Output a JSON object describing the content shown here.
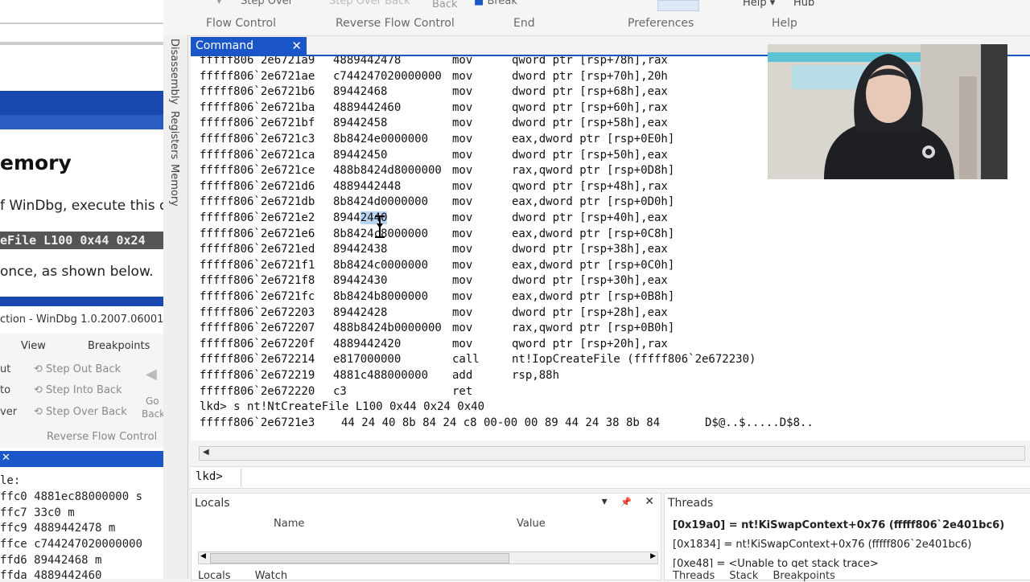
{
  "background_window": {
    "heading": "emory",
    "line1": "f WinDbg, execute this c",
    "code": "eFile L100 0x44 0x24",
    "line2": "once, as shown below.",
    "window_title": "ction  - WinDbg 1.0.2007.06001",
    "ribbon_tabs": [
      "View",
      "Breakpoints"
    ],
    "ribbon_left": [
      "ut",
      "to",
      "ver"
    ],
    "ribbon_items": [
      "Step Out Back",
      "Step Into Back",
      "Step Over Back"
    ],
    "ribbon_side": [
      "Go",
      "Back"
    ],
    "ribbon_group": "Reverse Flow Control",
    "close_glyph": "✕",
    "file_label": "le:",
    "asm_rows": [
      "ffc0 4881ec88000000  s",
      "ffc7 33c0              m",
      "ffc9 4889442478        m",
      "ffce c744247020000000",
      "ffd6 89442468          m",
      "ffda 4889442460"
    ]
  },
  "ribbon": {
    "top_items": [
      "Step Over",
      "Step Over Back",
      "Back",
      "Break"
    ],
    "groups": [
      "Flow Control",
      "Reverse Flow Control",
      "End",
      "Preferences",
      "Help"
    ],
    "help_menu": "Help ▾",
    "hub": "Hub"
  },
  "vertical_tabs": [
    "Disassembly",
    "Registers",
    "Memory"
  ],
  "command_tab": {
    "label": "Command",
    "close": "✕"
  },
  "disasm": [
    {
      "addr": "fffff806`2e6721a9",
      "bytes": "4889442478",
      "op": "mov",
      "args": "qword ptr [rsp+78h],rax"
    },
    {
      "addr": "fffff806`2e6721ae",
      "bytes": "c744247020000000",
      "op": "mov",
      "args": "dword ptr [rsp+70h],20h"
    },
    {
      "addr": "fffff806`2e6721b6",
      "bytes": "89442468",
      "op": "mov",
      "args": "dword ptr [rsp+68h],eax"
    },
    {
      "addr": "fffff806`2e6721ba",
      "bytes": "4889442460",
      "op": "mov",
      "args": "qword ptr [rsp+60h],rax"
    },
    {
      "addr": "fffff806`2e6721bf",
      "bytes": "89442458",
      "op": "mov",
      "args": "dword ptr [rsp+58h],eax"
    },
    {
      "addr": "fffff806`2e6721c3",
      "bytes": "8b8424e0000000",
      "op": "mov",
      "args": "eax,dword ptr [rsp+0E0h]"
    },
    {
      "addr": "fffff806`2e6721ca",
      "bytes": "89442450",
      "op": "mov",
      "args": "dword ptr [rsp+50h],eax"
    },
    {
      "addr": "fffff806`2e6721ce",
      "bytes": "488b8424d8000000",
      "op": "mov",
      "args": "rax,qword ptr [rsp+0D8h]"
    },
    {
      "addr": "fffff806`2e6721d6",
      "bytes": "4889442448",
      "op": "mov",
      "args": "qword ptr [rsp+48h],rax"
    },
    {
      "addr": "fffff806`2e6721db",
      "bytes": "8b8424d0000000",
      "op": "mov",
      "args": "eax,dword ptr [rsp+0D0h]"
    },
    {
      "addr": "fffff806`2e6721e2",
      "bytes": "89442440",
      "op": "mov",
      "args": "dword ptr [rsp+40h],eax"
    },
    {
      "addr": "fffff806`2e6721e6",
      "bytes": "8b8424c8000000",
      "op": "mov",
      "args": "eax,dword ptr [rsp+0C8h]"
    },
    {
      "addr": "fffff806`2e6721ed",
      "bytes": "89442438",
      "op": "mov",
      "args": "dword ptr [rsp+38h],eax"
    },
    {
      "addr": "fffff806`2e6721f1",
      "bytes": "8b8424c0000000",
      "op": "mov",
      "args": "eax,dword ptr [rsp+0C0h]"
    },
    {
      "addr": "fffff806`2e6721f8",
      "bytes": "89442430",
      "op": "mov",
      "args": "dword ptr [rsp+30h],eax"
    },
    {
      "addr": "fffff806`2e6721fc",
      "bytes": "8b8424b8000000",
      "op": "mov",
      "args": "eax,dword ptr [rsp+0B8h]"
    },
    {
      "addr": "fffff806`2e672203",
      "bytes": "89442428",
      "op": "mov",
      "args": "dword ptr [rsp+28h],eax"
    },
    {
      "addr": "fffff806`2e672207",
      "bytes": "488b8424b0000000",
      "op": "mov",
      "args": "rax,qword ptr [rsp+0B0h]"
    },
    {
      "addr": "fffff806`2e67220f",
      "bytes": "4889442420",
      "op": "mov",
      "args": "qword ptr [rsp+20h],rax"
    },
    {
      "addr": "fffff806`2e672214",
      "bytes": "e817000000",
      "op": "call",
      "args": "nt!IopCreateFile (fffff806`2e672230)"
    },
    {
      "addr": "fffff806`2e672219",
      "bytes": "4881c488000000",
      "op": "add",
      "args": "rsp,88h"
    },
    {
      "addr": "fffff806`2e672220",
      "bytes": "c3",
      "op": "ret",
      "args": ""
    }
  ],
  "highlight": {
    "prefix": "8944",
    "selected": "2440"
  },
  "command_line": "lkd> s nt!NtCreateFile L100 0x44 0x24 0x40",
  "search_result": {
    "addr": "fffff806`2e6721e3",
    "bytes": "44 24 40 8b 84 24 c8 00-00 00 89 44 24 38 8b 84",
    "ascii": "D$@..$.....D$8.."
  },
  "prompt": {
    "label": "lkd>",
    "value": ""
  },
  "locals": {
    "title": "Locals",
    "tools": [
      "▾",
      "📌",
      "✕"
    ],
    "columns": [
      "Name",
      "Value"
    ],
    "tabs": [
      "Locals",
      "Watch"
    ]
  },
  "threads": {
    "title": "Threads",
    "items": [
      "[0x19a0] = nt!KiSwapContext+0x76 (fffff806`2e401bc6)",
      "[0x1834] = nt!KiSwapContext+0x76 (fffff806`2e401bc6)",
      "[0xe48] = <Unable to get stack trace>"
    ],
    "tabs": [
      "Threads",
      "Stack",
      "Breakpoints"
    ]
  }
}
